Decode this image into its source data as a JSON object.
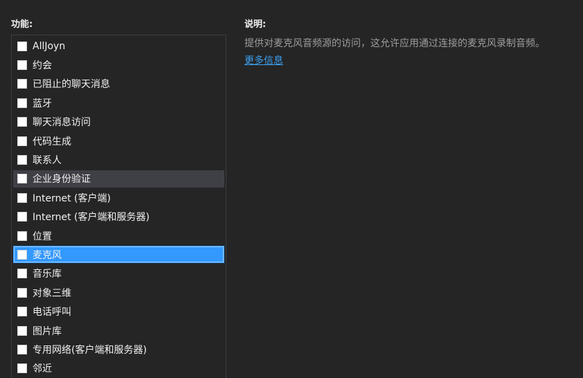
{
  "capabilities_panel": {
    "heading": "功能:",
    "items": [
      {
        "label": "AllJoyn",
        "checked": false,
        "state": "normal"
      },
      {
        "label": "约会",
        "checked": false,
        "state": "normal"
      },
      {
        "label": "已阻止的聊天消息",
        "checked": false,
        "state": "normal"
      },
      {
        "label": "蓝牙",
        "checked": false,
        "state": "normal"
      },
      {
        "label": "聊天消息访问",
        "checked": false,
        "state": "normal"
      },
      {
        "label": "代码生成",
        "checked": false,
        "state": "normal"
      },
      {
        "label": "联系人",
        "checked": false,
        "state": "normal"
      },
      {
        "label": "企业身份验证",
        "checked": false,
        "state": "hover"
      },
      {
        "label": "Internet (客户端)",
        "checked": false,
        "state": "normal"
      },
      {
        "label": "Internet (客户端和服务器)",
        "checked": false,
        "state": "normal"
      },
      {
        "label": "位置",
        "checked": false,
        "state": "normal"
      },
      {
        "label": "麦克风",
        "checked": false,
        "state": "selected"
      },
      {
        "label": "音乐库",
        "checked": false,
        "state": "normal"
      },
      {
        "label": "对象三维",
        "checked": false,
        "state": "normal"
      },
      {
        "label": "电话呼叫",
        "checked": false,
        "state": "normal"
      },
      {
        "label": "图片库",
        "checked": false,
        "state": "normal"
      },
      {
        "label": "专用网络(客户端和服务器)",
        "checked": false,
        "state": "normal"
      },
      {
        "label": "邻近",
        "checked": false,
        "state": "normal"
      }
    ]
  },
  "description_panel": {
    "heading": "说明:",
    "text": "提供对麦克风音频源的访问，这允许应用通过连接的麦克风录制音频。",
    "link_label": "更多信息"
  },
  "colors": {
    "background": "#252526",
    "selected": "#3399ff",
    "hover": "#3f3f46",
    "link": "#3ca1f0",
    "description_text": "#9d9d9d"
  }
}
